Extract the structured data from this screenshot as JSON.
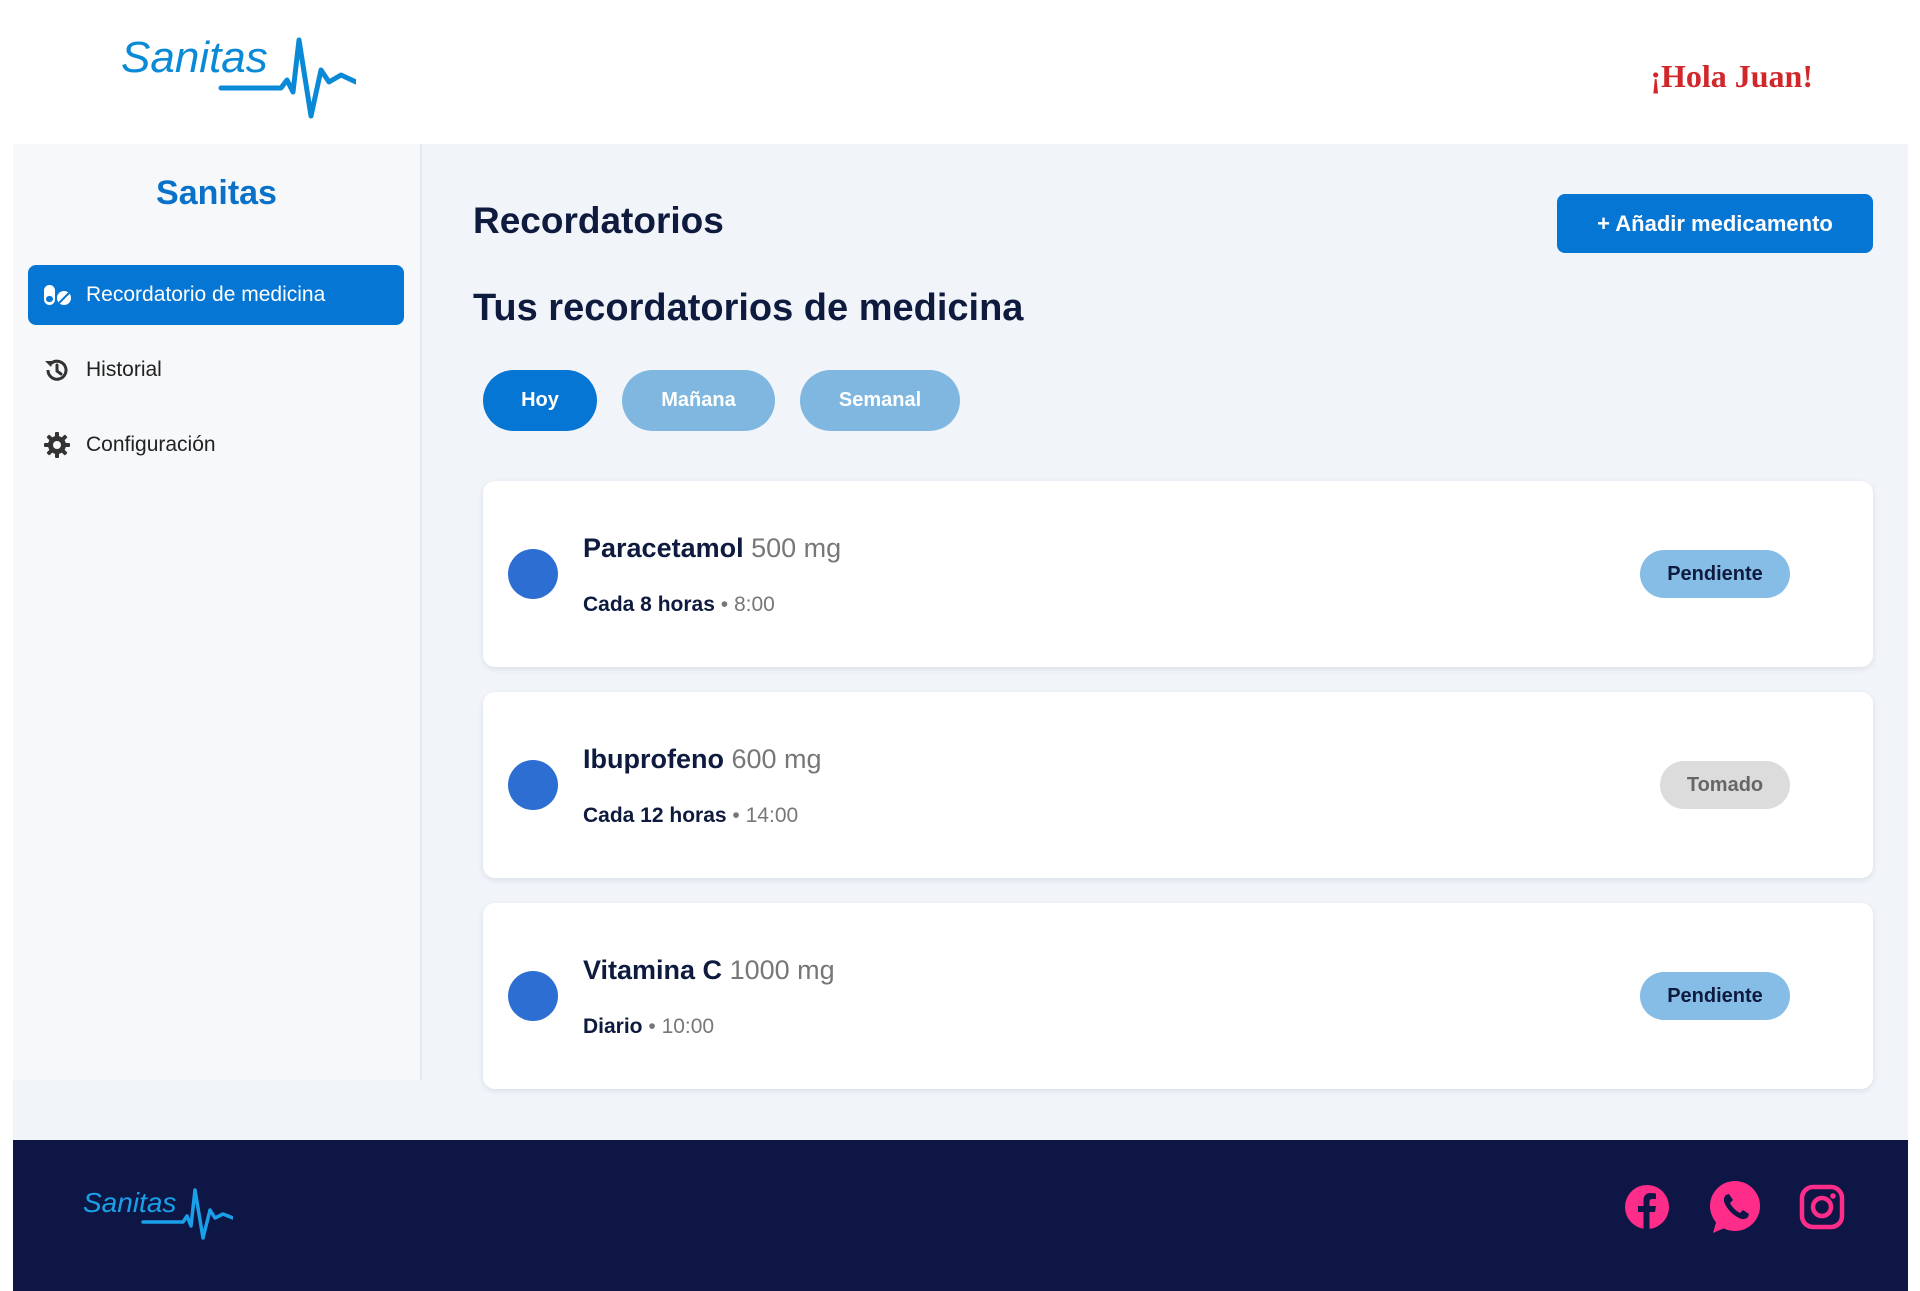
{
  "header": {
    "logo_text": "Sanitas",
    "greeting": "¡Hola Juan!"
  },
  "sidebar": {
    "brand": "Sanitas",
    "items": [
      {
        "label": "Recordatorio de medicina",
        "icon": "pills-icon",
        "active": true
      },
      {
        "label": "Historial",
        "icon": "history-icon",
        "active": false
      },
      {
        "label": "Configuración",
        "icon": "gear-icon",
        "active": false
      }
    ]
  },
  "main": {
    "page_title": "Recordatorios",
    "add_button_label": "+ Añadir medicamento",
    "section_title": "Tus recordatorios de medicina",
    "tabs": [
      {
        "label": "Hoy",
        "active": true
      },
      {
        "label": "Mañana",
        "active": false
      },
      {
        "label": "Semanal",
        "active": false
      }
    ],
    "reminders": [
      {
        "name": "Paracetamol",
        "dose": "500 mg",
        "frequency": "Cada 8 horas",
        "separator": "•",
        "time": "8:00",
        "status": "Pendiente"
      },
      {
        "name": "Ibuprofeno",
        "dose": "600 mg",
        "frequency": "Cada 12 horas",
        "separator": "•",
        "time": "14:00",
        "status": "Tomado"
      },
      {
        "name": "Vitamina C",
        "dose": "1000 mg",
        "frequency": "Diario",
        "separator": "•",
        "time": "10:00",
        "status": "Pendiente"
      }
    ]
  },
  "footer": {
    "logo_text": "Sanitas",
    "social": [
      "facebook-icon",
      "whatsapp-icon",
      "instagram-icon"
    ]
  },
  "colors": {
    "primary": "#0676d4",
    "navy": "#0e1a3e",
    "footer_bg": "#0d1644",
    "greeting_red": "#d1272b",
    "social_pink": "#ff2d8a",
    "pending_badge": "#85bde6",
    "taken_badge": "#dcdcdc"
  }
}
